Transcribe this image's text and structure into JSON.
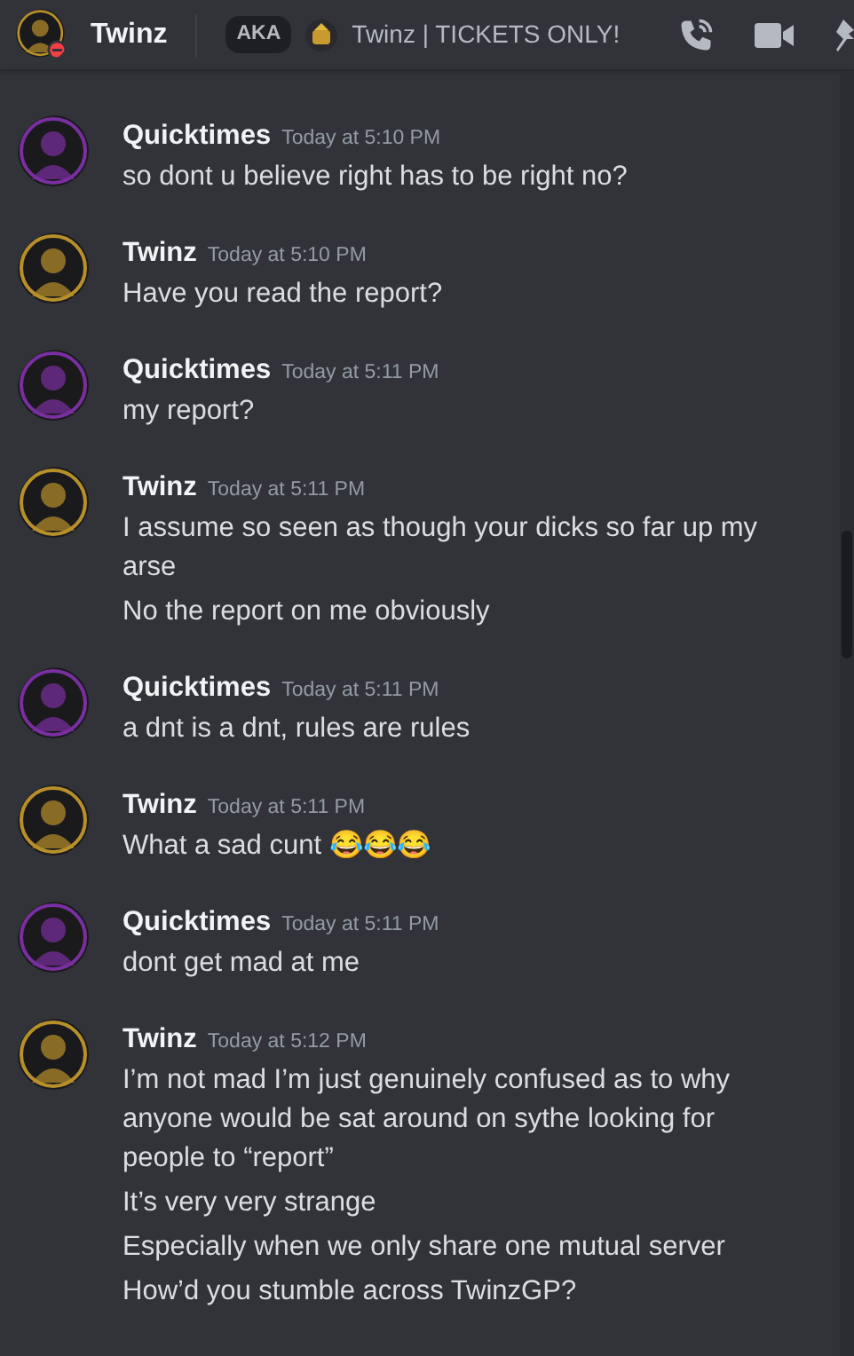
{
  "header": {
    "name": "Twinz",
    "dnd": true,
    "aka": "AKA",
    "nickname": "Twinz | TICKETS ONLY!"
  },
  "groups": [
    {
      "author": "Quicktimes",
      "color": "#7a2fa0",
      "time": "Today at 5:10 PM",
      "messages": [
        "so dont u believe right has to be right no?"
      ]
    },
    {
      "author": "Twinz",
      "color": "#b8902a",
      "time": "Today at 5:10 PM",
      "messages": [
        "Have you read the report?"
      ]
    },
    {
      "author": "Quicktimes",
      "color": "#7a2fa0",
      "time": "Today at 5:11 PM",
      "messages": [
        "my report?"
      ]
    },
    {
      "author": "Twinz",
      "color": "#b8902a",
      "time": "Today at 5:11 PM",
      "messages": [
        "I assume so seen as though your dicks so far up my arse",
        "No the report on me obviously"
      ]
    },
    {
      "author": "Quicktimes",
      "color": "#7a2fa0",
      "time": "Today at 5:11 PM",
      "messages": [
        "a dnt is a dnt, rules are rules"
      ]
    },
    {
      "author": "Twinz",
      "color": "#b8902a",
      "time": "Today at 5:11 PM",
      "messages": [
        "What a sad cunt 😂😂😂"
      ]
    },
    {
      "author": "Quicktimes",
      "color": "#7a2fa0",
      "time": "Today at 5:11 PM",
      "messages": [
        "dont get mad at me"
      ]
    },
    {
      "author": "Twinz",
      "color": "#b8902a",
      "time": "Today at 5:12 PM",
      "messages": [
        "I’m not mad I’m just genuinely confused as to why anyone would be sat around on sythe looking for people to “report”",
        "It’s very very strange",
        "Especially when we only share one mutual server",
        "How’d you stumble across TwinzGP?"
      ]
    }
  ]
}
